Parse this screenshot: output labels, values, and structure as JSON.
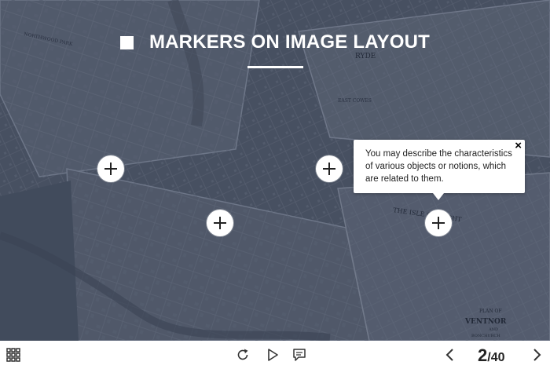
{
  "slide": {
    "title": "MARKERS ON IMAGE LAYOUT",
    "tooltip_text": "You may describe the characteristics of various objects or notions, which are related to them.",
    "tooltip_close": "×"
  },
  "map_labels": {
    "ryde": "RYDE",
    "isle": "THE ISLE OF WIGHT",
    "plan_of": "PLAN OF",
    "ventnor": "VENTNOR",
    "and": "AND",
    "bonchurch": "BONCHURCH",
    "northwood": "NORTHWOOD PARK",
    "east_cowes": "EAST COWES"
  },
  "player": {
    "current_slide": "2",
    "total_slides": "/40"
  },
  "icons": [
    "grid-menu-icon",
    "replay-icon",
    "play-icon",
    "comment-icon",
    "prev-icon",
    "next-icon",
    "plus-icon",
    "close-icon",
    "title-square-icon"
  ]
}
